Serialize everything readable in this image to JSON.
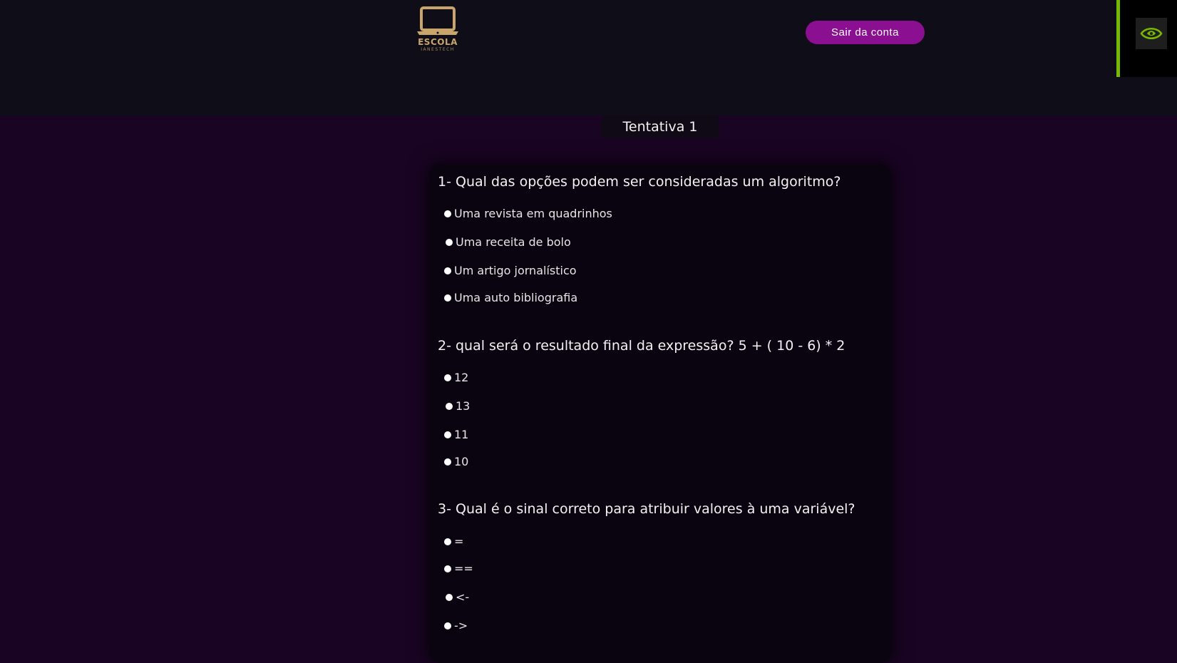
{
  "header": {
    "logo_title": "ESCOLA",
    "logo_subtitle": "IANESTECH",
    "logout_label": "Sair da conta",
    "logo_color": "#c9a46b",
    "button_color": "#8b0f91"
  },
  "extension": {
    "icon": "nvidia-eye-icon",
    "accent": "#76b900"
  },
  "attempt_label": "Tentativa 1",
  "questions": [
    {
      "text": "1- Qual das opções podem ser consideradas um algoritmo?",
      "options": [
        "Uma revista em quadrinhos",
        "Uma receita de bolo",
        "Um artigo jornalístico",
        "Uma auto bibliografia"
      ]
    },
    {
      "text": "2- qual será o resultado final da expressão? 5 + ( 10 - 6) * 2",
      "options": [
        "12",
        "13",
        "11",
        "10"
      ]
    },
    {
      "text": "3- Qual é o sinal correto para atribuir valores à uma variável?",
      "options": [
        "=",
        "==",
        "<-",
        "->"
      ]
    }
  ]
}
